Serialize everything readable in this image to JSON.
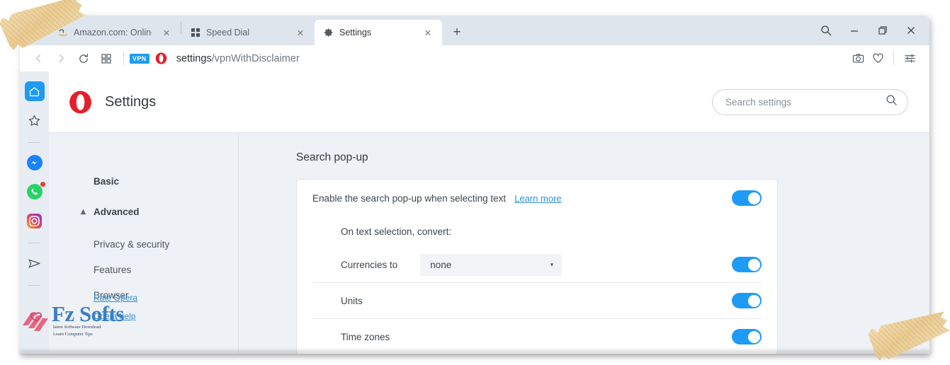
{
  "browser": {
    "tabs": [
      {
        "title": "Amazon.com: Online Shopp",
        "favicon": "amazon-icon",
        "active": false,
        "close": "✕"
      },
      {
        "title": "Speed Dial",
        "favicon": "speed-dial-icon",
        "active": false,
        "close": "✕"
      },
      {
        "title": "Settings",
        "favicon": "gear-icon",
        "active": true,
        "close": "✕"
      }
    ],
    "new_tab_label": "+",
    "window_controls": {
      "search": "search-icon",
      "minimize": "—",
      "maximize": "restore-icon",
      "close": "✕"
    },
    "toolbar": {
      "back": "‹",
      "forward": "›",
      "reload": "reload-icon",
      "speed_dial": "speed-dial-icon",
      "vpn_label": "VPN",
      "opera_badge": "opera-icon",
      "url_prefix": "settings",
      "url_path": "/vpnWithDisclaimer",
      "snapshot": "camera-icon",
      "heart": "heart-icon",
      "easy_setup": "sliders-icon"
    }
  },
  "app_sidebar": {
    "items": [
      {
        "name": "home-icon",
        "selected": true
      },
      {
        "name": "favorites-star-icon",
        "selected": false
      },
      {
        "name": "messenger-icon",
        "selected": false,
        "badge": false
      },
      {
        "name": "whatsapp-icon",
        "selected": false,
        "badge": true
      },
      {
        "name": "instagram-icon",
        "selected": false,
        "badge": false
      },
      {
        "name": "telegram-icon",
        "selected": false,
        "badge": false
      }
    ]
  },
  "settings_header": {
    "logo": "opera-logo",
    "title": "Settings",
    "search": {
      "placeholder": "Search settings",
      "value": "",
      "icon": "search-icon"
    }
  },
  "settings_nav": {
    "items": [
      {
        "label": "Basic",
        "bold": true,
        "chevron": ""
      },
      {
        "label": "Advanced",
        "bold": true,
        "chevron": "▴"
      },
      {
        "label": "Privacy & security",
        "bold": false,
        "chevron": ""
      },
      {
        "label": "Features",
        "bold": false,
        "chevron": ""
      },
      {
        "label": "Browser",
        "bold": false,
        "chevron": ""
      }
    ],
    "bottom_links": [
      {
        "label": "Rate Opera"
      },
      {
        "label": "Opera help"
      }
    ]
  },
  "content": {
    "section_title": "Search pop-up",
    "enable_row": {
      "label": "Enable the search pop-up when selecting text",
      "link": "Learn more",
      "toggle_on": true
    },
    "subhead": "On text selection, convert:",
    "rows": [
      {
        "label": "Currencies to",
        "select_value": "none",
        "select_caret": "▾",
        "toggle_on": true
      },
      {
        "label": "Units",
        "toggle_on": true
      },
      {
        "label": "Time zones",
        "toggle_on": true
      }
    ]
  },
  "watermark": {
    "brand": "Fz Softs",
    "tagline_line1": "latest Software Download",
    "tagline_line2": "Learn Computer Tips"
  },
  "colors": {
    "accent_blue": "#1f9bf5",
    "opera_red": "#e4202b",
    "link_blue": "#2f8fd8",
    "page_bg": "#eef1f5",
    "tabbar_bg": "#dfe5ec"
  }
}
